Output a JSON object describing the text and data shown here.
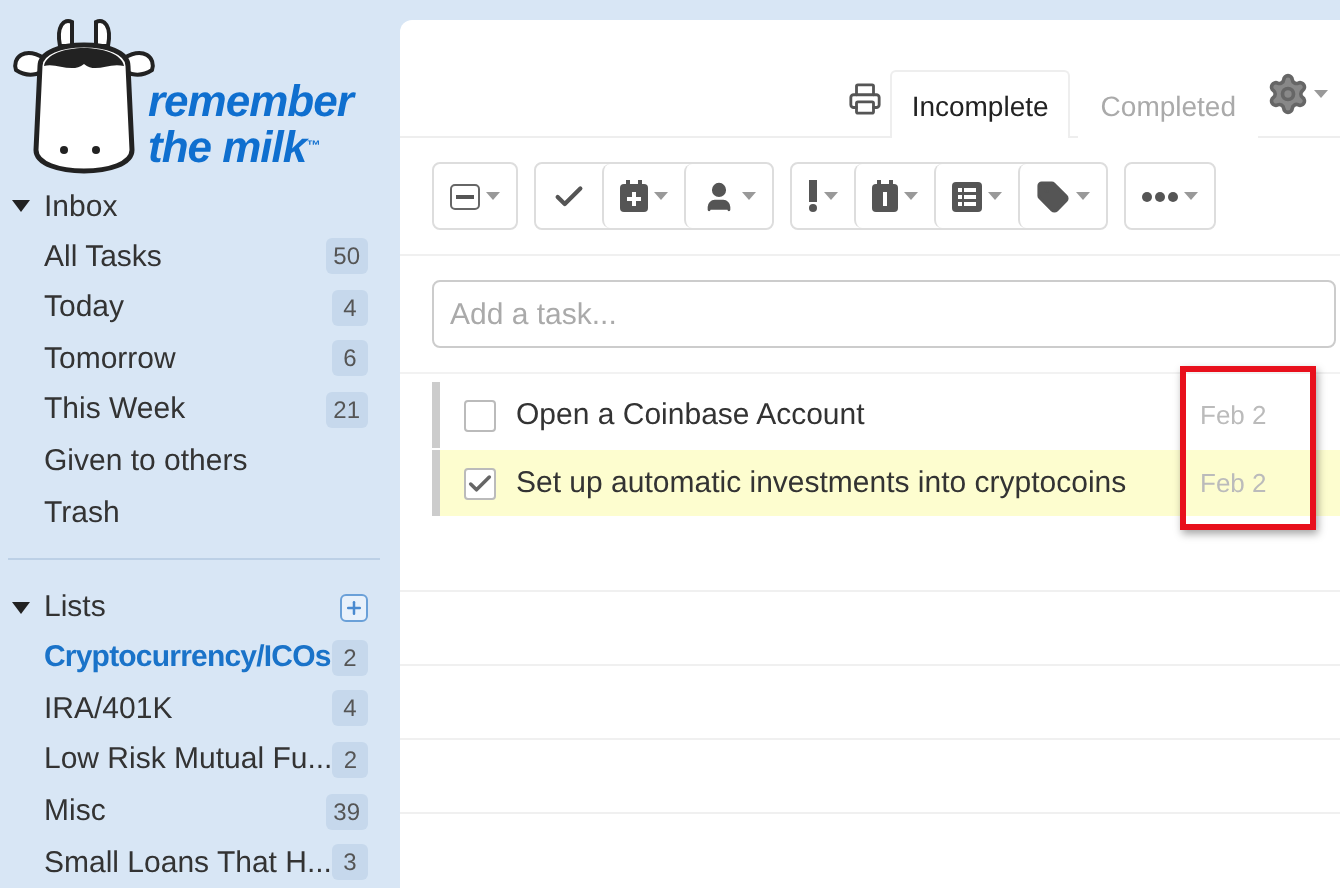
{
  "logo": {
    "line1": "remember",
    "line2": "the milk",
    "mark": "™"
  },
  "sidebar": {
    "sections": [
      {
        "title": "Inbox",
        "expanded": true,
        "add_button": false,
        "items": [
          {
            "label": "All Tasks",
            "count": "50",
            "selected": false
          },
          {
            "label": "Today",
            "count": "4",
            "selected": false
          },
          {
            "label": "Tomorrow",
            "count": "6",
            "selected": false
          },
          {
            "label": "This Week",
            "count": "21",
            "selected": false
          },
          {
            "label": "Given to others",
            "selected": false
          },
          {
            "label": "Trash",
            "selected": false
          }
        ]
      },
      {
        "title": "Lists",
        "expanded": true,
        "add_button": true,
        "items": [
          {
            "label": "Cryptocurrency/ICOs",
            "count": "2",
            "selected": true
          },
          {
            "label": "IRA/401K",
            "count": "4",
            "selected": false
          },
          {
            "label": "Low Risk Mutual Fu...",
            "count": "2",
            "selected": false
          },
          {
            "label": "Misc",
            "count": "39",
            "selected": false
          },
          {
            "label": "Small Loans That H...",
            "count": "3",
            "selected": false
          }
        ]
      }
    ]
  },
  "tabs": [
    {
      "label": "Incomplete",
      "selected": true
    },
    {
      "label": "Completed",
      "selected": false
    }
  ],
  "toolbar": {
    "groups": [
      [
        {
          "kind": "select",
          "dropdown": true
        }
      ],
      [
        {
          "kind": "complete",
          "dropdown": false
        },
        {
          "kind": "postpone",
          "dropdown": true
        },
        {
          "kind": "assign",
          "dropdown": true
        }
      ],
      [
        {
          "kind": "priority",
          "dropdown": true
        },
        {
          "kind": "due",
          "dropdown": true
        },
        {
          "kind": "list",
          "dropdown": true
        },
        {
          "kind": "tag",
          "dropdown": true
        }
      ],
      [
        {
          "kind": "more",
          "dropdown": true
        }
      ]
    ]
  },
  "add_task": {
    "placeholder": "Add a task..."
  },
  "tasks": [
    {
      "title": "Open a Coinbase Account",
      "due": "Feb 2",
      "checked": false,
      "selected": false
    },
    {
      "title": "Set up automatic investments into cryptocoins",
      "due": "Feb 2",
      "checked": true,
      "selected": true
    }
  ],
  "highlight_dates": true
}
